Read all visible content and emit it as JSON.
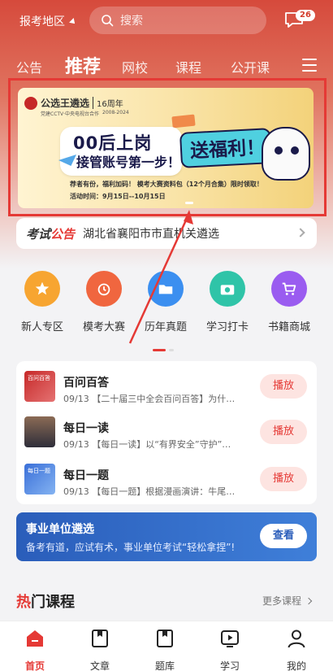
{
  "header": {
    "region": "报考地区",
    "search_placeholder": "搜索",
    "message_count": "26",
    "tabs": [
      "公告",
      "推荐",
      "网校",
      "课程",
      "公开课"
    ],
    "active_tab": "推荐"
  },
  "banner": {
    "brand": "公选王遴选",
    "anniversary": "16周年",
    "subtitle": "党建CCTV·中央电视台合作",
    "years": "2008-2024",
    "line1": "00后上岗",
    "line2": "接管账号第一步！",
    "gift": "送福利！",
    "info1": "荐者有份，福利加码！ 模考大赛资料包（12个月合集）限时领取！",
    "info2": "活动时间：9月15日--10月15日"
  },
  "notice": {
    "tag_plain": "考试",
    "tag_red": "公告",
    "text": "湖北省襄阳市市直机关遴选"
  },
  "shortcuts": [
    {
      "label": "新人专区",
      "icon": "star-icon",
      "color": "#f7a531"
    },
    {
      "label": "模考大赛",
      "icon": "alarm-icon",
      "color": "#f0663f"
    },
    {
      "label": "历年真题",
      "icon": "folder-icon",
      "color": "#3b8ff0"
    },
    {
      "label": "学习打卡",
      "icon": "camera-icon",
      "color": "#2fc4a8"
    },
    {
      "label": "书籍商城",
      "icon": "cart-icon",
      "color": "#9a5cf0"
    }
  ],
  "list": [
    {
      "title": "百问百答",
      "sub": "09/13 【二十届三中全会百问百答】为什…",
      "action": "播放",
      "thumb_text": "百问百答"
    },
    {
      "title": "每日一读",
      "sub": "09/13 【每日一读】以“有界安全”守护”…",
      "action": "播放",
      "thumb_text": ""
    },
    {
      "title": "每日一题",
      "sub": "09/13 【每日一题】根据漫画演讲：牛尾…",
      "action": "播放",
      "thumb_text": "每日一题"
    }
  ],
  "unit_card": {
    "title": "事业单位遴选",
    "sub": "备考有道，应试有术，事业单位考试“轻松拿捏”!",
    "button": "查看"
  },
  "hot": {
    "plain_a": "热",
    "plain_b": "门课程",
    "more": "更多课程"
  },
  "nav": [
    {
      "label": "首页",
      "icon": "home-icon",
      "active": true
    },
    {
      "label": "文章",
      "icon": "bookmark-icon",
      "active": false
    },
    {
      "label": "题库",
      "icon": "bookmark-icon",
      "active": false
    },
    {
      "label": "学习",
      "icon": "play-icon",
      "active": false
    },
    {
      "label": "我的",
      "icon": "user-icon",
      "active": false
    }
  ],
  "colors": {
    "brand_red": "#e53935",
    "unit_blue": "#2a5dba"
  }
}
